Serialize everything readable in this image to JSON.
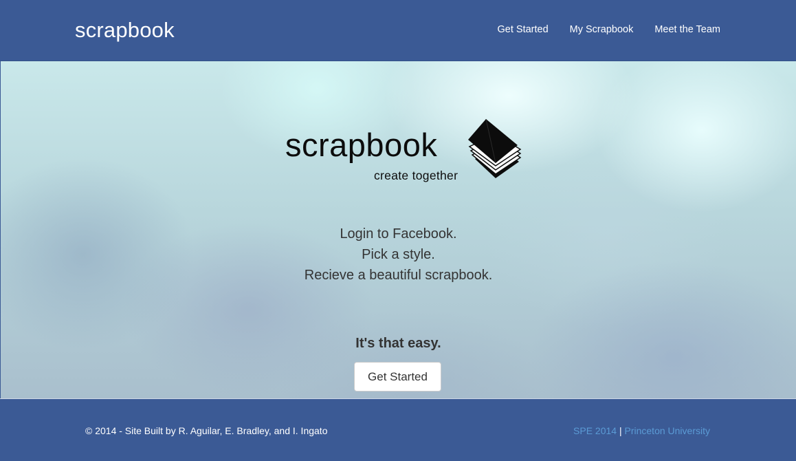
{
  "navbar": {
    "brand": "scrapbook",
    "links": [
      {
        "label": "Get Started"
      },
      {
        "label": "My Scrapbook"
      },
      {
        "label": "Meet the Team"
      }
    ]
  },
  "hero": {
    "logo_text": "scrapbook",
    "logo_tagline": "create together",
    "logo_icon": "book-icon",
    "steps": [
      "Login to Facebook.",
      "Pick a style.",
      "Recieve a beautiful scrapbook."
    ],
    "tagline": "It's that easy.",
    "cta_label": "Get Started"
  },
  "footer": {
    "copyright": "© 2014 - Site Built by R. Aguilar, E. Bradley, and I. Ingato",
    "link_spe": "SPE 2014",
    "separator": "|",
    "link_princeton": "Princeton University"
  },
  "colors": {
    "brand_blue": "#3b5a95",
    "footer_link": "#5b9bd5",
    "body_text": "#333333"
  }
}
